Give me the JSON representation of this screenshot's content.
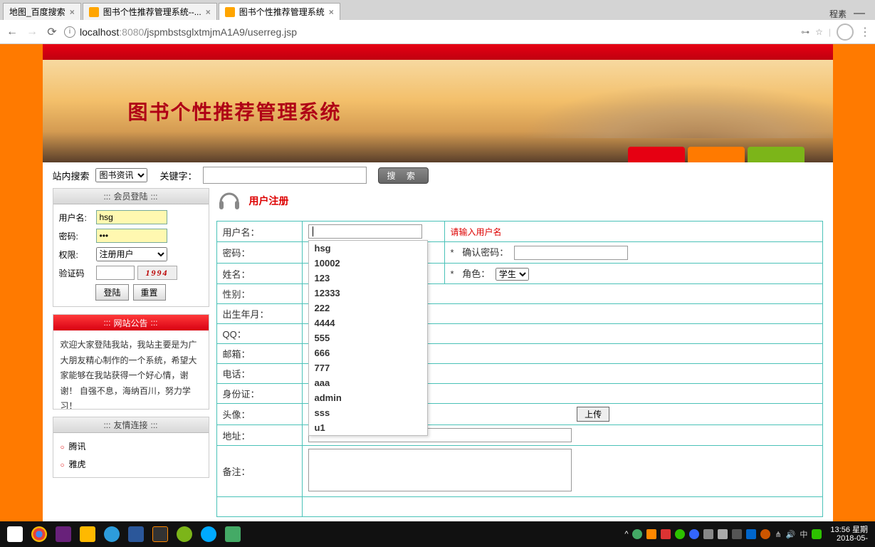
{
  "tabs": [
    {
      "title": "地图_百度搜索"
    },
    {
      "title": "图书个性推荐管理系统--..."
    },
    {
      "title": "图书个性推荐管理系统"
    }
  ],
  "window_label": "程素",
  "url": {
    "host": "localhost",
    "port": ":8080",
    "path": "/jspmbstsglxtmjmA1A9/userreg.jsp"
  },
  "banner_title": "图书个性推荐管理系统",
  "search": {
    "label": "站内搜索",
    "select": "图书资讯",
    "kw_label": "关键字：",
    "btn": "搜 索"
  },
  "login": {
    "header": "会员登陆",
    "user_label": "用户名:",
    "user_value": "hsg",
    "pwd_label": "密码:",
    "pwd_value": "•••",
    "perm_label": "权限:",
    "perm_value": "注册用户",
    "captcha_label": "验证码",
    "captcha_value": "1994",
    "btn_login": "登陆",
    "btn_reset": "重置"
  },
  "announce": {
    "header": "网站公告",
    "body": "    欢迎大家登陆我站，我站主要是为广大朋友精心制作的一个系统，希望大家能够在我站获得一个好心情，谢谢！    自强不息，海纳百川，努力学习！"
  },
  "links": {
    "header": "友情连接",
    "items": [
      "腾讯",
      "雅虎"
    ]
  },
  "reg": {
    "title": "用户注册",
    "fields": {
      "username": "用户名：",
      "username_err": "请输入用户名",
      "password": "密码：",
      "confirm": "确认密码：",
      "name": "姓名：",
      "role": "角色：",
      "role_value": "学生",
      "gender": "性别：",
      "birth": "出生年月：",
      "qq": "QQ：",
      "email": "邮箱：",
      "phone": "电话：",
      "idcard": "身份证：",
      "avatar": "头像：",
      "upload": "上传",
      "address": "地址：",
      "remark": "备注："
    }
  },
  "autocomplete": [
    "hsg",
    "10002",
    "123",
    "12333",
    "222",
    "4444",
    "555",
    "666",
    "777",
    "aaa",
    "admin",
    "sss",
    "u1"
  ],
  "clock": {
    "time": "13:56",
    "date": "2018-05-",
    "day": "星期"
  }
}
